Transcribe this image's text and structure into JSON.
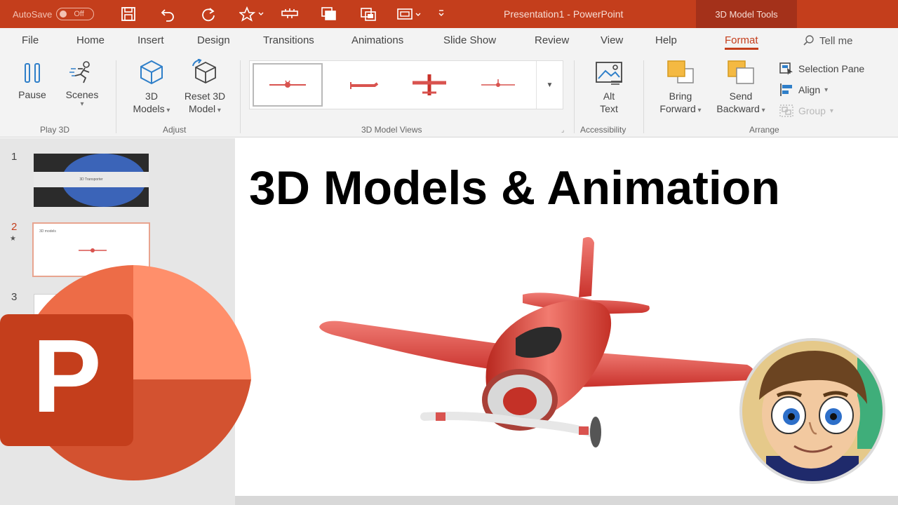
{
  "titlebar": {
    "autosave_label": "AutoSave",
    "autosave_state": "Off",
    "document_title": "Presentation1 - PowerPoint",
    "context_tab": "3D Model Tools",
    "qat_icons": [
      "save-icon",
      "undo-icon",
      "redo-icon",
      "star-icon",
      "ruler-icon",
      "duplicate-icon",
      "present-icon",
      "screen-icon",
      "customize-icon"
    ]
  },
  "tabs": [
    "File",
    "Home",
    "Insert",
    "Design",
    "Transitions",
    "Animations",
    "Slide Show",
    "Review",
    "View",
    "Help",
    "Format"
  ],
  "active_tab": "Format",
  "tell_me": "Tell me",
  "ribbon": {
    "play3d": {
      "label": "Play 3D",
      "pause": "Pause",
      "scenes": "Scenes"
    },
    "adjust": {
      "label": "Adjust",
      "models_l1": "3D",
      "models_l2": "Models",
      "reset_l1": "Reset 3D",
      "reset_l2": "Model"
    },
    "views": {
      "label": "3D Model Views"
    },
    "accessibility": {
      "label": "Accessibility",
      "alt_l1": "Alt",
      "alt_l2": "Text"
    },
    "arrange": {
      "label": "Arrange",
      "bring_l1": "Bring",
      "bring_l2": "Forward",
      "send_l1": "Send",
      "send_l2": "Backward",
      "selection_pane": "Selection Pane",
      "align": "Align",
      "group": "Group"
    }
  },
  "slides_pane": {
    "numbers": [
      "1",
      "2",
      "3"
    ],
    "slide1_caption": "3D Transporter",
    "slide2_caption": "3D models"
  },
  "slide": {
    "title": "3D Models & Animation"
  },
  "logo": {
    "letter": "P"
  },
  "colors": {
    "accent": "#c43e1c",
    "title_bar": "#c43e1c",
    "airplane": "#e2534f",
    "ribbon_bg": "#f3f3f3"
  }
}
